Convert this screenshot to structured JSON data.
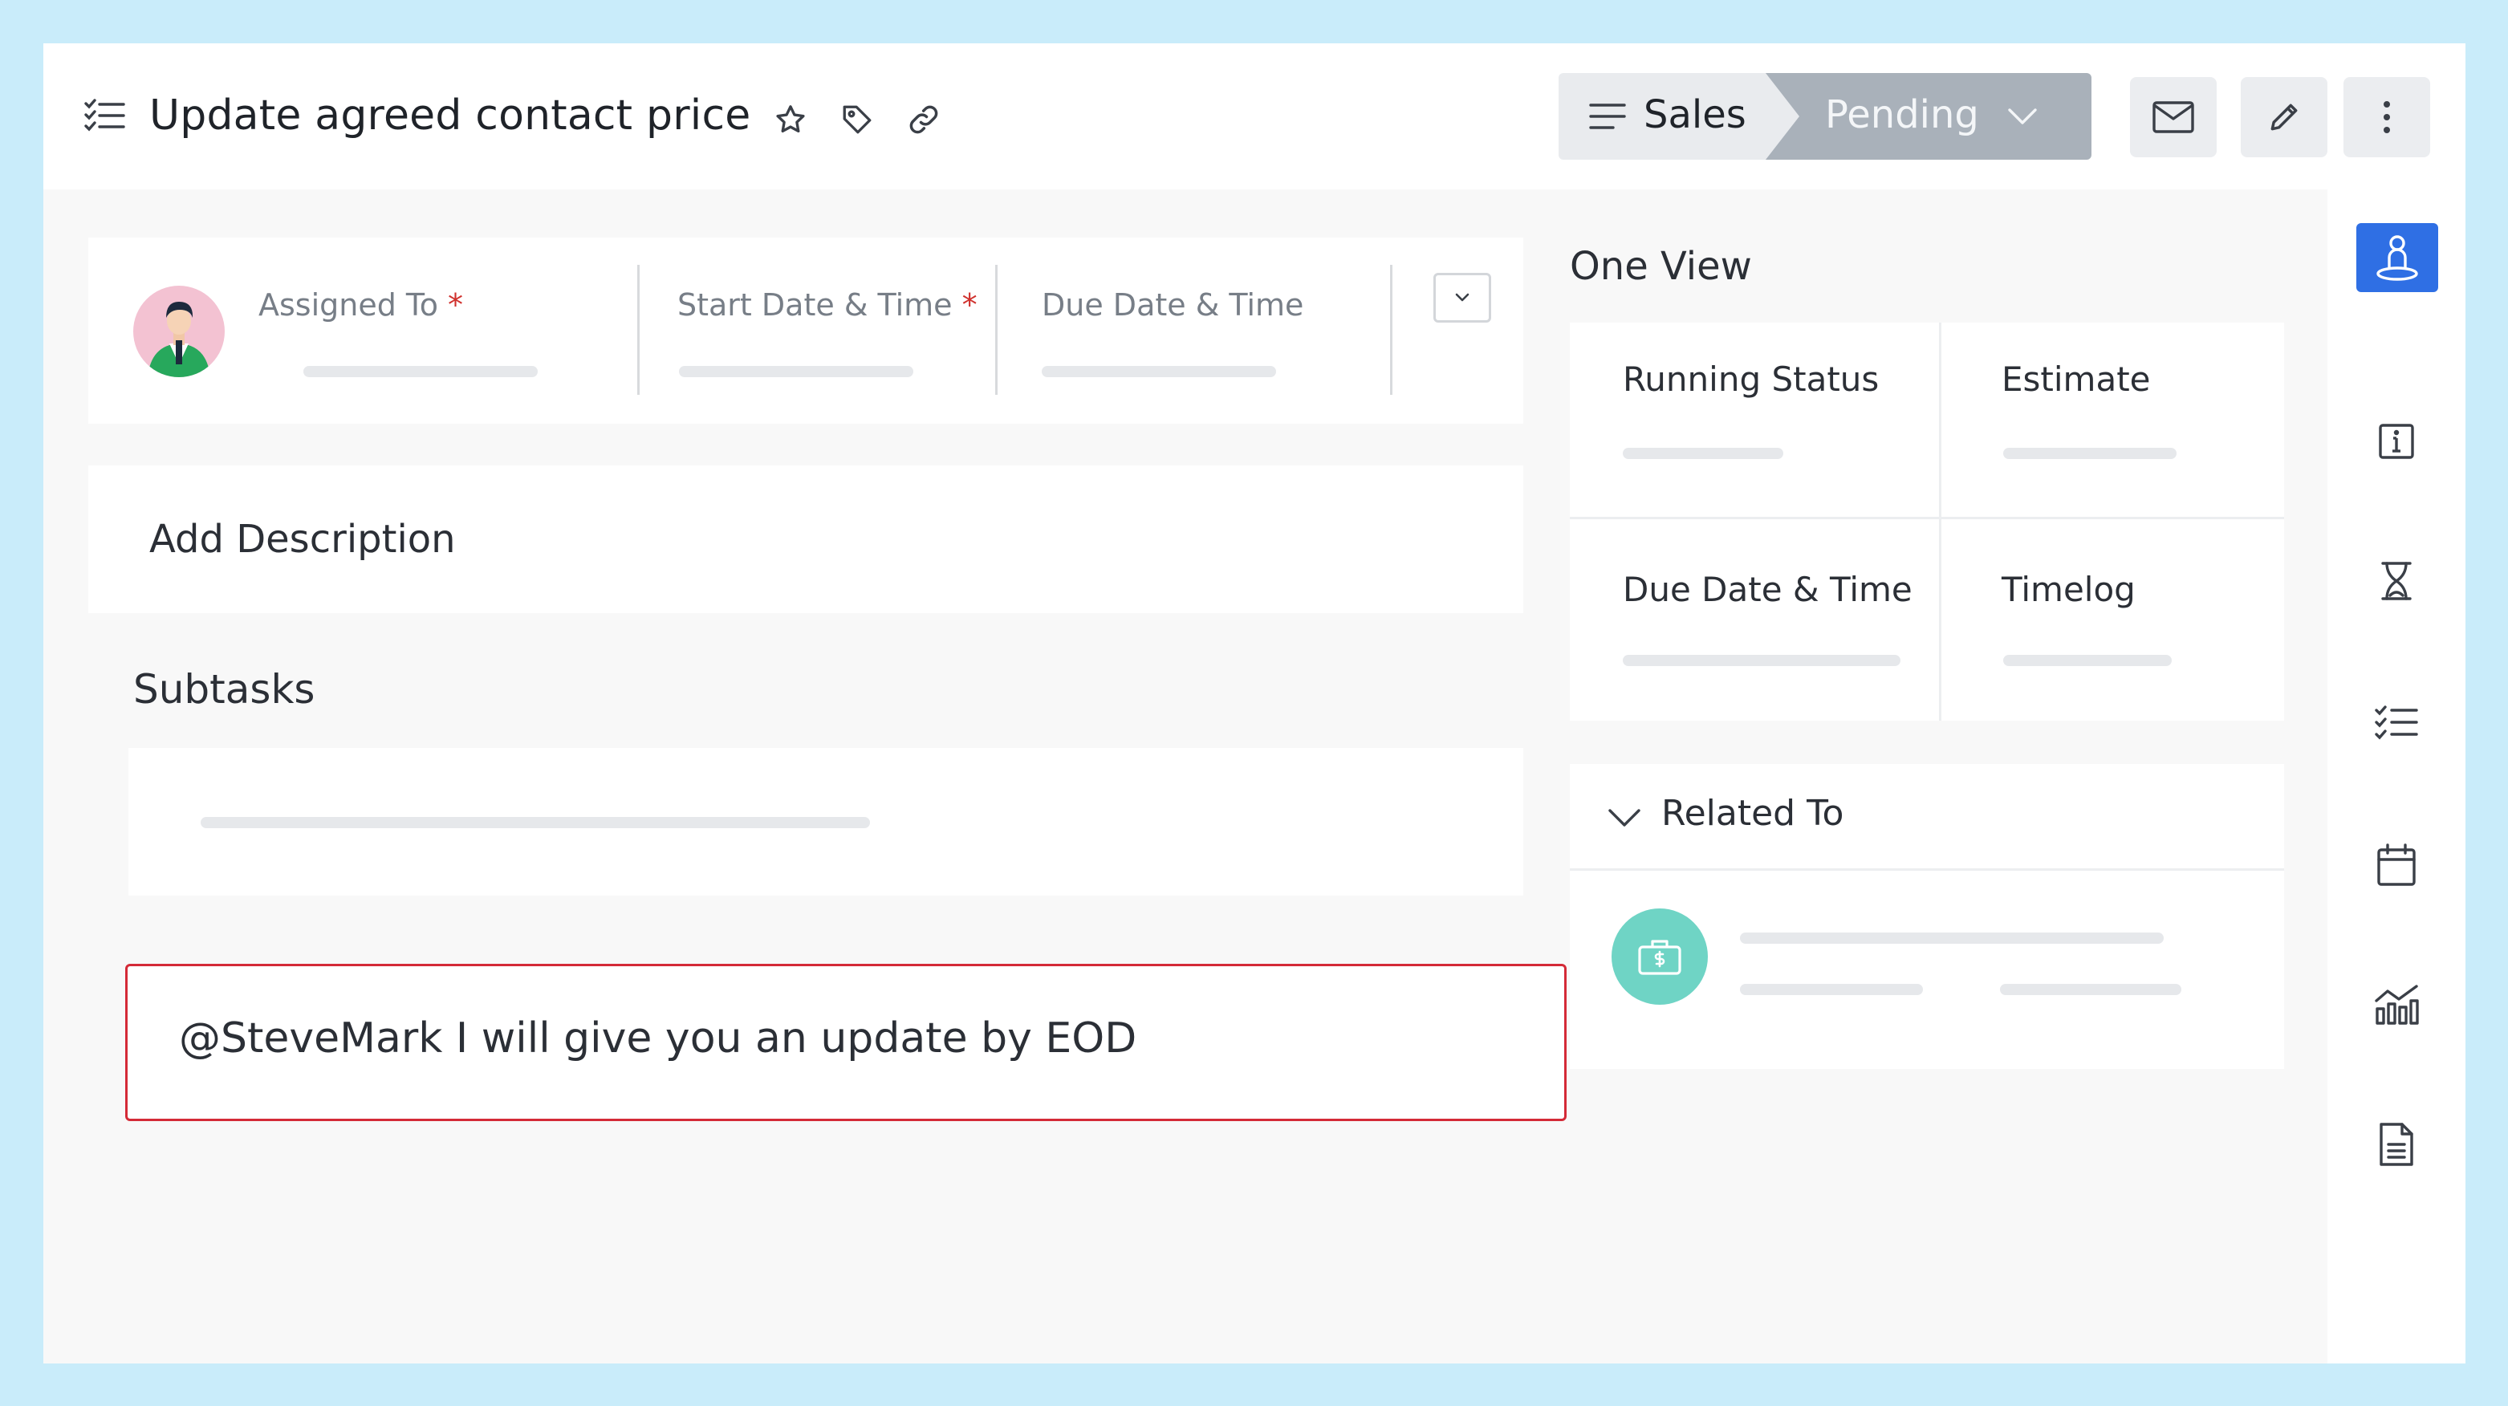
{
  "header": {
    "title": "Update agreed contact price",
    "stage_current": "Sales",
    "stage_next": "Pending"
  },
  "fields": {
    "assigned_to": "Assigned To",
    "start_date": "Start Date & Time",
    "due_date": "Due Date & Time",
    "required_mark": "*"
  },
  "description": {
    "label": "Add Description"
  },
  "subtasks": {
    "title": "Subtasks"
  },
  "comment": {
    "text": "@SteveMark  I will give you an update by EOD"
  },
  "one_view": {
    "title": "One View",
    "cells": [
      "Running Status",
      "Estimate",
      "Due Date & Time",
      "Timelog"
    ]
  },
  "related": {
    "title": "Related To"
  },
  "colors": {
    "accent": "#2f6fe4",
    "error_border": "#d42a37",
    "stage_active": "#a9b1ba",
    "related_avatar": "#6fd4c5"
  },
  "icons": {
    "header": [
      "task-list-icon",
      "star-icon",
      "tag-icon",
      "link-icon",
      "mail-icon",
      "pencil-icon",
      "more-vertical-icon"
    ],
    "sidebar": [
      "person-pin-icon",
      "info-icon",
      "hourglass-icon",
      "checklist-icon",
      "calendar-icon",
      "analytics-icon",
      "document-icon"
    ]
  }
}
